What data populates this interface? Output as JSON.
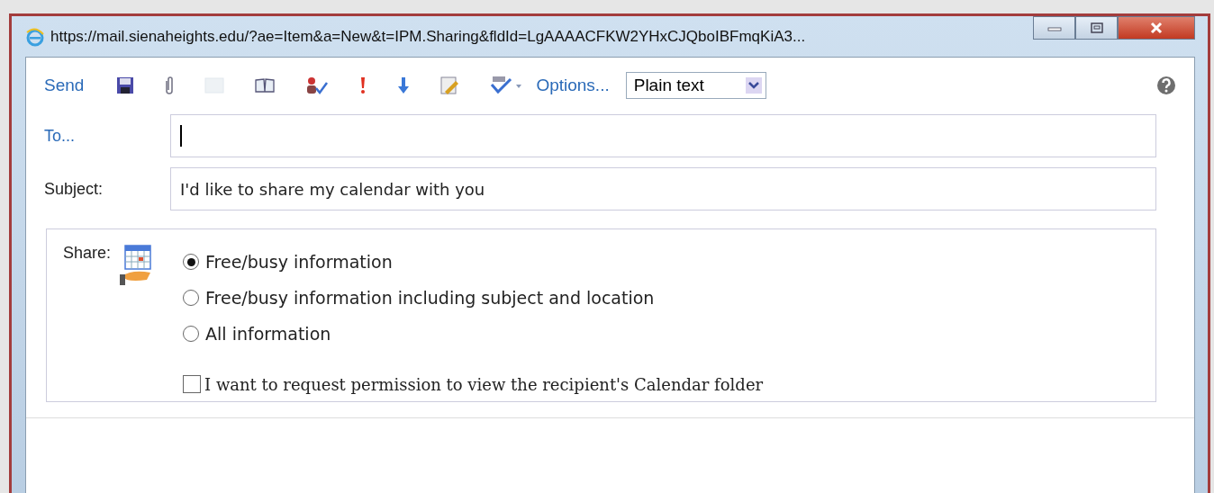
{
  "window": {
    "title": "https://mail.sienaheights.edu/?ae=Item&a=New&t=IPM.Sharing&fldId=LgAAAACFKW2YHxCJQboIBFmqKiA3..."
  },
  "toolbar": {
    "send": "Send",
    "options": "Options...",
    "format": "Plain text"
  },
  "to": {
    "label": "To..."
  },
  "subject": {
    "label": "Subject:",
    "value": "I'd like to share my calendar with you"
  },
  "share": {
    "label": "Share:",
    "options": [
      {
        "label": "Free/busy information",
        "selected": true
      },
      {
        "label": "Free/busy information including subject and location",
        "selected": false
      },
      {
        "label": "All information",
        "selected": false
      }
    ],
    "request": {
      "label": "I want to request permission to view the recipient's Calendar folder",
      "checked": false
    }
  }
}
